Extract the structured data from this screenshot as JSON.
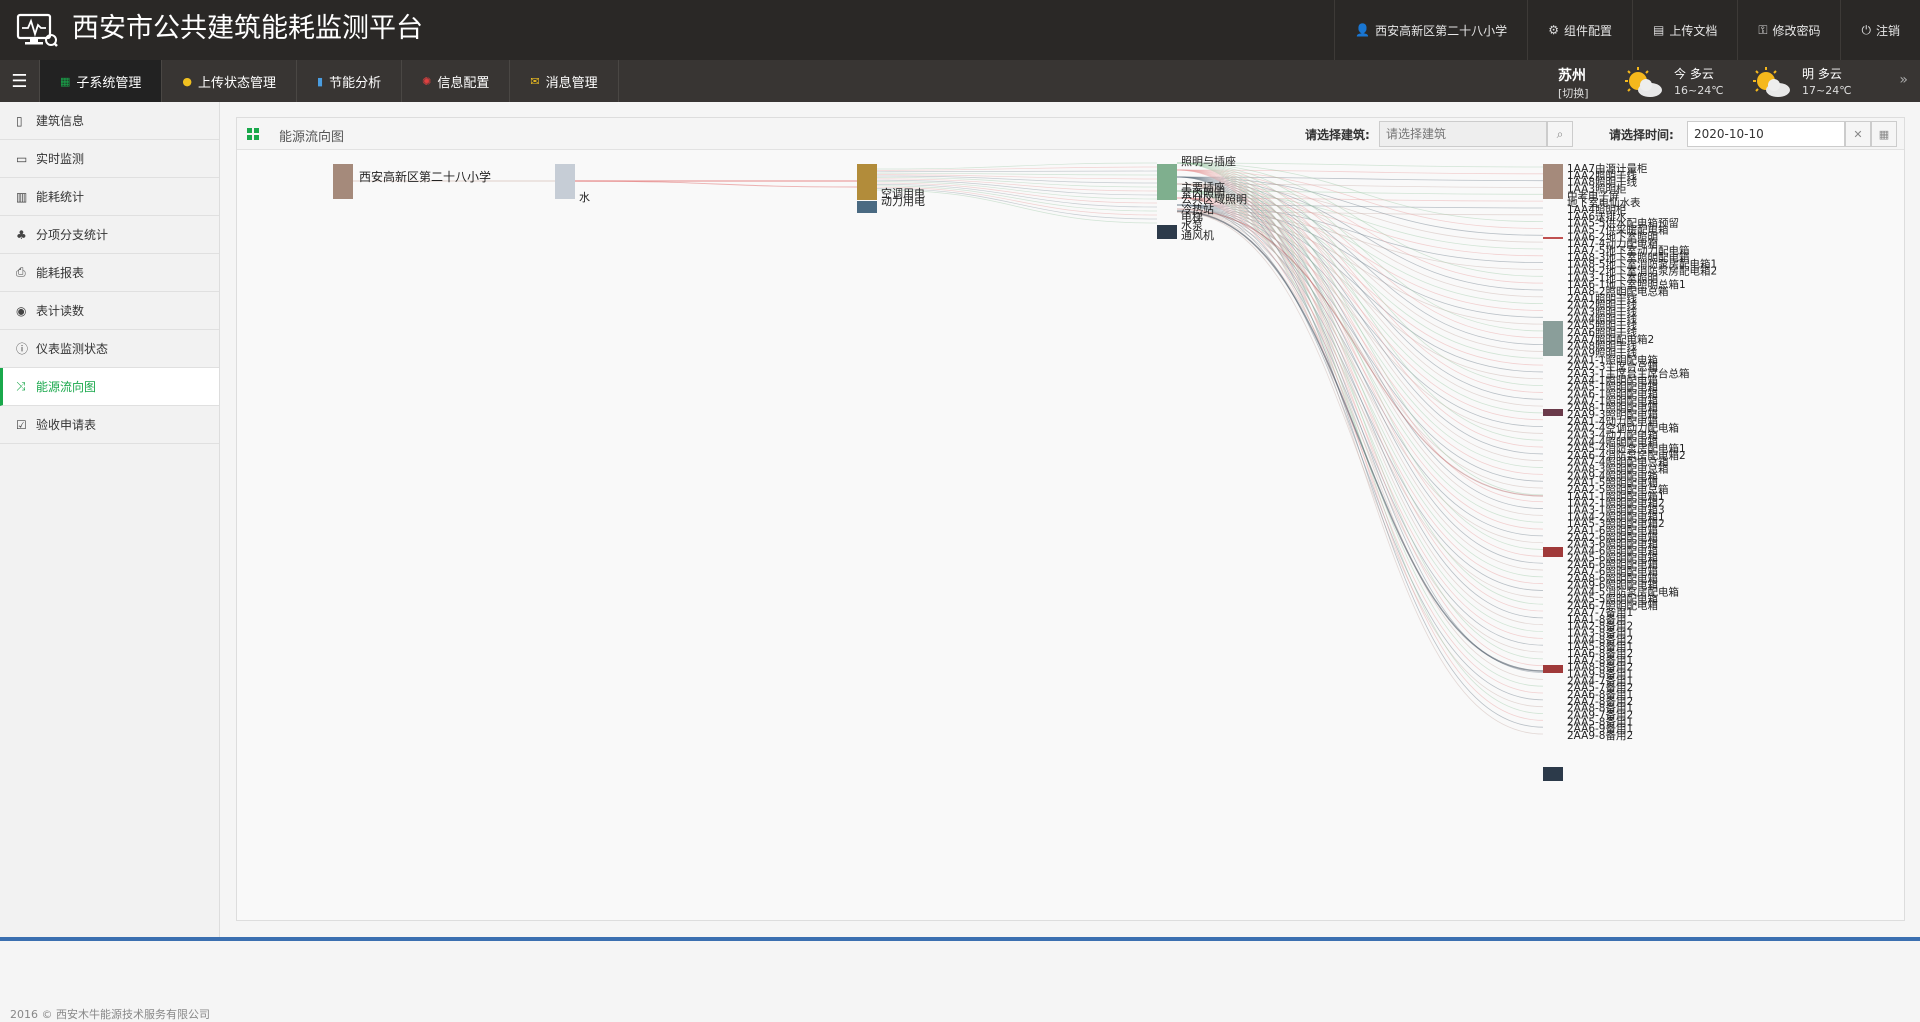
{
  "app": {
    "title": "西安市公共建筑能耗监测平台"
  },
  "header_links": [
    {
      "icon": "user-icon",
      "glyph": "👤",
      "label": "西安高新区第二十八小学"
    },
    {
      "icon": "gear-icon",
      "glyph": "⚙",
      "label": "组件配置"
    },
    {
      "icon": "book-icon",
      "glyph": "▤",
      "label": "上传文档"
    },
    {
      "icon": "key-icon",
      "glyph": "⚿",
      "label": "修改密码"
    },
    {
      "icon": "power-icon",
      "glyph": "⏻",
      "label": "注销"
    }
  ],
  "nav": {
    "tabs": [
      {
        "label": "子系统管理",
        "icon": "grid-icon",
        "glyph": "▦",
        "color": "#19a84b",
        "active": true
      },
      {
        "label": "上传状态管理",
        "icon": "exclamation-icon",
        "glyph": "●",
        "color": "#f0c020"
      },
      {
        "label": "节能分析",
        "icon": "bar-chart-icon",
        "glyph": "▮",
        "color": "#4a9de0"
      },
      {
        "label": "信息配置",
        "icon": "cog-icon",
        "glyph": "✺",
        "color": "#e04040"
      },
      {
        "label": "消息管理",
        "icon": "envelope-icon",
        "glyph": "✉",
        "color": "#f0c020"
      }
    ]
  },
  "weather": {
    "city": "苏州",
    "switch": "[切换]",
    "today": {
      "day": "今",
      "cond": "多云",
      "temp": "16~24℃"
    },
    "tomorrow": {
      "day": "明",
      "cond": "多云",
      "temp": "17~24℃"
    },
    "next": "»"
  },
  "sidebar": {
    "items": [
      {
        "label": "建筑信息",
        "icon": "building-icon",
        "glyph": "▯"
      },
      {
        "label": "实时监测",
        "icon": "laptop-icon",
        "glyph": "▭"
      },
      {
        "label": "能耗统计",
        "icon": "bar-chart-icon",
        "glyph": "▥"
      },
      {
        "label": "分项分支统计",
        "icon": "sitemap-icon",
        "glyph": "♣"
      },
      {
        "label": "能耗报表",
        "icon": "print-icon",
        "glyph": "⎙"
      },
      {
        "label": "表计读数",
        "icon": "dashboard-icon",
        "glyph": "◉"
      },
      {
        "label": "仪表监测状态",
        "icon": "info-icon",
        "glyph": "ⓘ"
      },
      {
        "label": "能源流向图",
        "icon": "random-icon",
        "glyph": "⤨",
        "active": true
      },
      {
        "label": "验收申请表",
        "icon": "check-icon",
        "glyph": "☑"
      }
    ],
    "footer": "2016 © 西安木牛能源技术服务有限公司"
  },
  "panel": {
    "title": "能源流向图",
    "building_label": "请选择建筑:",
    "building_placeholder": "请选择建筑",
    "time_label": "请选择时间:",
    "date_value": "2020-10-10"
  },
  "sankey": {
    "col1": [
      {
        "label": "西安高新区第二十八小学",
        "color": "#a58a7b"
      }
    ],
    "col2": [
      {
        "label": "水",
        "color": "#c6cdd6"
      }
    ],
    "col3": [
      {
        "label": "空调用电",
        "color": "#b28c3a"
      },
      {
        "label": "动力用电",
        "color": "#4a6a82"
      }
    ],
    "col4": [
      {
        "label": "照明与插座",
        "color": "#7faf8e"
      },
      {
        "label": "主要插座",
        "color": ""
      },
      {
        "label": "室内照明",
        "color": ""
      },
      {
        "label": "公共区域照明",
        "color": ""
      },
      {
        "label": "冷热站",
        "color": ""
      },
      {
        "label": "电梯",
        "color": ""
      },
      {
        "label": "水泵",
        "color": ""
      },
      {
        "label": "通风机",
        "color": "#2c3a4a"
      }
    ],
    "col5_blocks": [
      {
        "color": "#a58a7b"
      },
      {
        "color": "#c05050"
      },
      {
        "color": "#8a9e9a"
      },
      {
        "color": "#6a3a4a"
      },
      {
        "color": "#a03a3a"
      },
      {
        "color": "#a03a3a"
      },
      {
        "color": "#2c3a4a"
      }
    ],
    "col5_labels": [
      "1AA7由源计量柜",
      "1AA2照明干线",
      "1AA8照明干线",
      "1AA3照明柜",
      "中考电子屏",
      "地下室电仙水表",
      "1AA4照明柜",
      "1AA6送排水",
      "1AA5-5供水配电箱预留",
      "1AA5-7供采暖配电箱",
      "1AA6-2地下室照明",
      "1AA7-4动力配电箱",
      "1AA7-5地下室动力配电箱",
      "1AA8-3地下室照明配电箱",
      "1AA8-5地下室消防泵房配电箱1",
      "1AA9-2地下室消防泵房配电箱2",
      "1AA3-1地下室照明",
      "1AA6-1地下室照明总箱1",
      "1AA8-2照明配电总箱",
      "2AA1照明干线",
      "2AA2照明干线",
      "2AA3照明干线",
      "2AA4照明干线",
      "2AA5照明干线",
      "2AA6照明干线",
      "2AA7照明配电箱2",
      "2AA8照明干线",
      "2AA9照明干线",
      "2AA1-1照明配电箱",
      "2AA2-3主席台总箱",
      "2AA3-1主席台主席台总箱",
      "2AA4-1照明配电箱",
      "2AA5-1照明配电箱",
      "2AA6-1照明配电箱",
      "2AA7-1照明配电箱",
      "2AA8-1照明配电箱",
      "2AA9-3照明配电箱",
      "2AA1-4动力配电箱",
      "2AA2-4空调动力配电箱",
      "2AA3-4动力配电箱",
      "2AA4-4照明配电箱",
      "2AA5-4消防泵房配电箱1",
      "2AA6-4消防泵房配电箱2",
      "2AA7-4照明配电总箱",
      "2AA8-3照明配电总箱",
      "2AA9-4照明配电箱",
      "2AA1-5照明配电箱",
      "2AA2-5照明配电总箱",
      "1AA1-1照明配电箱1",
      "1AA2-1照明配电箱2",
      "1AA3-1照明配电箱3",
      "1AA4-2照明配电箱1",
      "1AA5-3照明配电箱2",
      "2AA1-6照明配电箱",
      "2AA2-6照明配电箱",
      "2AA3-6照明配电箱",
      "2AA4-6照明配电箱",
      "2AA5-6照明配电箱",
      "2AA6-6照明配电箱",
      "2AA7-6照明配电箱",
      "2AA8-6照明配电箱",
      "2AA9-6照明配电箱",
      "2AA4-5消防泵房配电箱",
      "2AA5-5照明配电箱",
      "2AA6-7照明配电箱",
      "2AA7-7备用1",
      "1AA1-8备用",
      "1AA2-8备用2",
      "1AA3-8备用1",
      "1AA4-8备用2",
      "1AA5-8备用1",
      "1AA6-8备用2",
      "1AA7-8备用1",
      "1AA8-8备用2",
      "1AA9-8备用1",
      "2AA4-7备用1",
      "2AA5-7备用2",
      "2AA6-8备用1",
      "2AA7-8备用2",
      "2AA8-8备用1",
      "2AA9-7备用2",
      "2AA5-8备用1",
      "2AA6-9备用1",
      "2AA9-8备用2"
    ]
  }
}
